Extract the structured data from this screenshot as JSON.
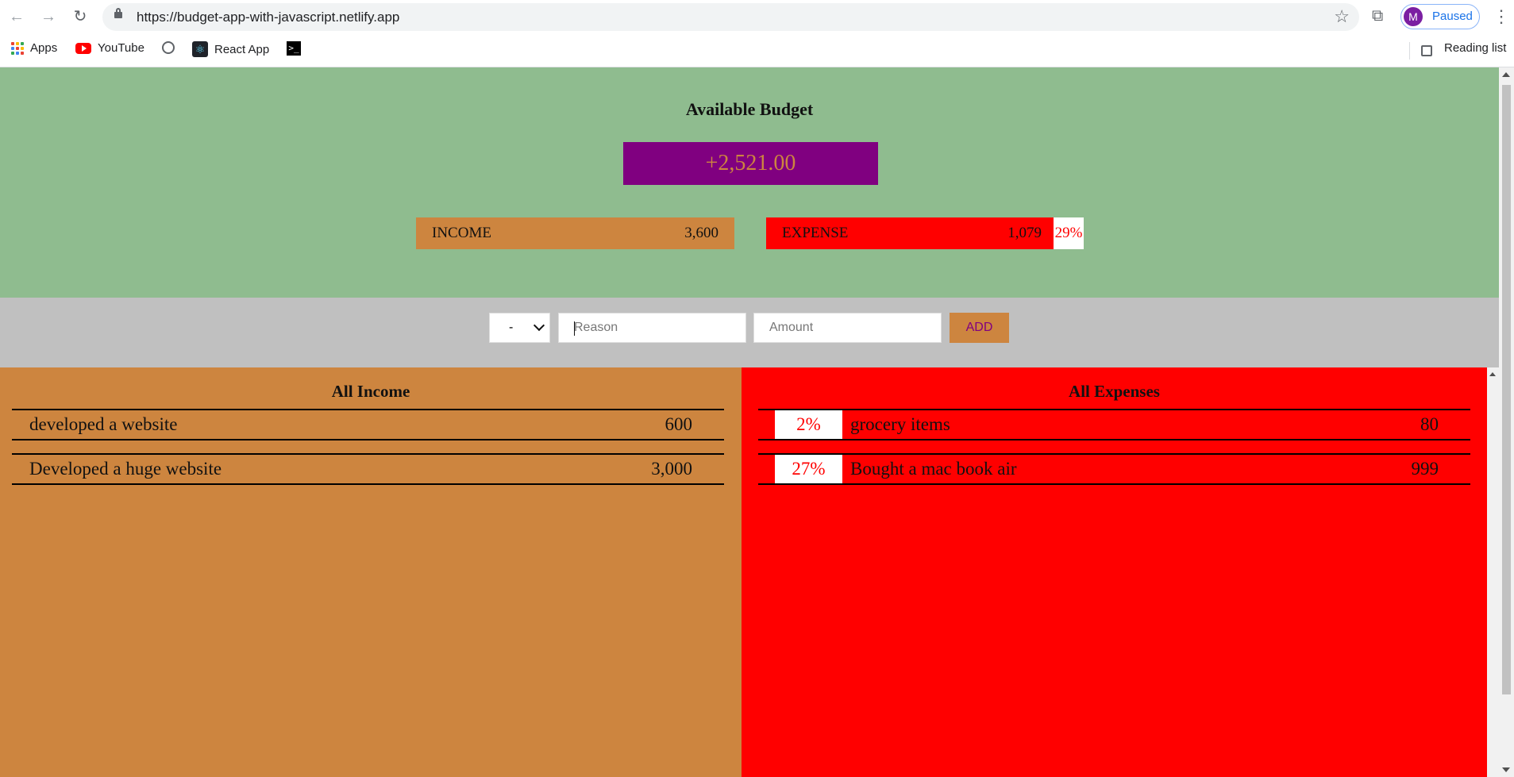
{
  "browser": {
    "url": "https://budget-app-with-javascript.netlify.app",
    "profile_initial": "M",
    "profile_status": "Paused",
    "bookmarks": [
      "Apps",
      "YouTube",
      "React App"
    ],
    "reading_list": "Reading list"
  },
  "header": {
    "title": "Available Budget",
    "budget": "+2,521.00"
  },
  "summary": {
    "income_label": "INCOME",
    "income_value": "3,600",
    "expense_label": "EXPENSE",
    "expense_value": "1,079",
    "expense_percent": "29%"
  },
  "form": {
    "type_value": "-",
    "reason_placeholder": "Reason",
    "amount_placeholder": "Amount",
    "add_label": "ADD"
  },
  "income": {
    "title": "All Income",
    "items": [
      {
        "desc": "developed a website",
        "amount": "600"
      },
      {
        "desc": "Developed a huge website",
        "amount": "3,000"
      }
    ]
  },
  "expenses": {
    "title": "All Expenses",
    "items": [
      {
        "percent": "2%",
        "desc": "grocery items",
        "amount": "80"
      },
      {
        "percent": "27%",
        "desc": "Bought a mac book air",
        "amount": "999"
      }
    ]
  },
  "colors": {
    "top_bg": "#8fbc8f",
    "budget_bg": "#800080",
    "income": "#cd853f",
    "expense": "#ff0000",
    "controls_bg": "#c0c0c0"
  }
}
